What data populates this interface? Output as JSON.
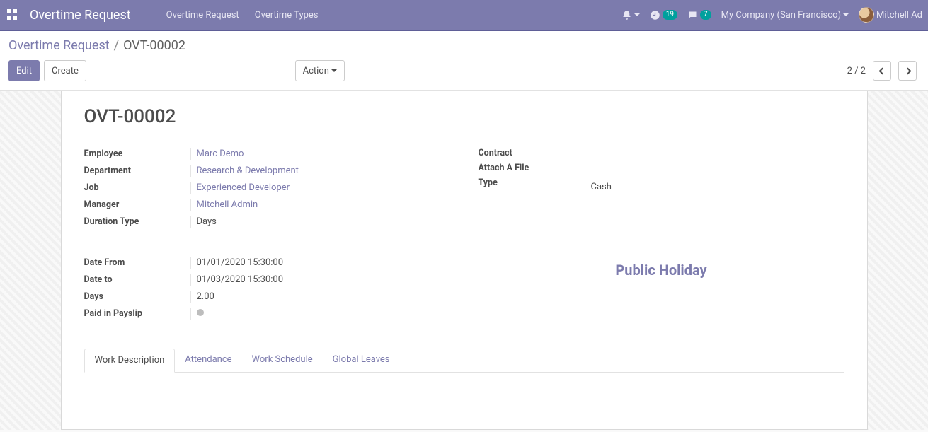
{
  "nav": {
    "app_name": "Overtime Request",
    "menu": {
      "m1": "Overtime Request",
      "m2": "Overtime Types"
    },
    "systray": {
      "timer_badge": "19",
      "msg_badge": "7",
      "company": "My Company (San Francisco)",
      "user": "Mitchell Ad"
    }
  },
  "cp": {
    "breadcrumb_root": "Overtime Request",
    "breadcrumb_sep": "/",
    "breadcrumb_current": "OVT-00002",
    "btn_edit": "Edit",
    "btn_create": "Create",
    "btn_action": "Action",
    "pager": "2 / 2"
  },
  "form": {
    "title": "OVT-00002",
    "left1": {
      "employee_l": "Employee",
      "employee_v": "Marc Demo",
      "department_l": "Department",
      "department_v": "Research & Development",
      "job_l": "Job",
      "job_v": "Experienced Developer",
      "manager_l": "Manager",
      "manager_v": "Mitchell Admin",
      "duration_type_l": "Duration Type",
      "duration_type_v": "Days"
    },
    "right1": {
      "contract_l": "Contract",
      "contract_v": "",
      "attach_l": "Attach A File",
      "attach_v": "",
      "type_l": "Type",
      "type_v": "Cash"
    },
    "left2": {
      "date_from_l": "Date From",
      "date_from_v": "01/01/2020 15:30:00",
      "date_to_l": "Date to",
      "date_to_v": "01/03/2020 15:30:00",
      "days_l": "Days",
      "days_v": "2.00",
      "paid_l": "Paid in Payslip"
    },
    "public_holiday": "Public Holiday",
    "tabs": {
      "t1": "Work Description",
      "t2": "Attendance",
      "t3": "Work Schedule",
      "t4": "Global Leaves"
    }
  }
}
